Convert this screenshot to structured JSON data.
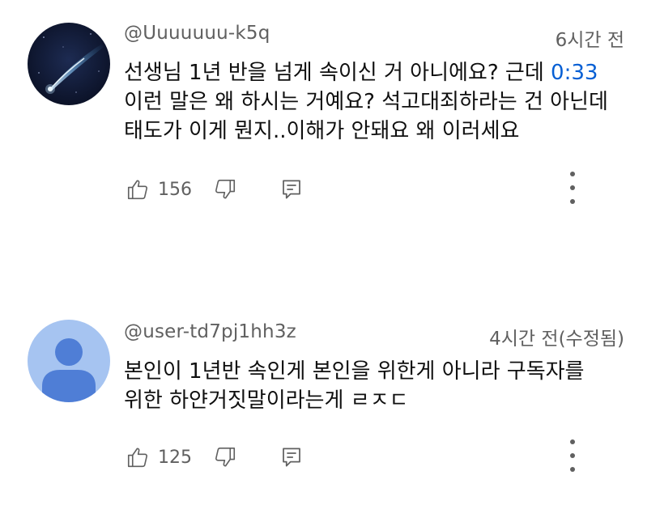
{
  "comments": [
    {
      "author": "@Uuuuuuu-k5q",
      "time": "6시간 전",
      "text_line1_before": "선생님 1년 반을 넘게 속이신 거 아니에요? 근데 ",
      "timestamp_link": "0:33",
      "text_line2": "이런 말은 왜 하시는 거예요? 석고대죄하라는 건 아닌데",
      "text_line3": "태도가 이게 뭔지..이해가 안돼요 왜 이러세요",
      "likes": "156",
      "avatar": "comet-night-sky"
    },
    {
      "author": "@user-td7pj1hh3z",
      "time": "4시간 전(수정됨)",
      "text_line1": "본인이 1년반 속인게 본인을 위한게 아니라 구독자를",
      "text_line2": "위한 하얀거짓말이라는게 ㄹㅈㄷ",
      "likes": "125",
      "avatar": "default-person"
    }
  ],
  "icons": {
    "like": "thumb-up-icon",
    "dislike": "thumb-down-icon",
    "reply": "reply-icon",
    "more": "more-vertical-icon"
  },
  "colors": {
    "link": "#065fd4",
    "meta": "#606060",
    "text": "#0f0f0f",
    "default_avatar_bg": "#a6c4f1",
    "default_avatar_fg": "#4f7ed6"
  }
}
